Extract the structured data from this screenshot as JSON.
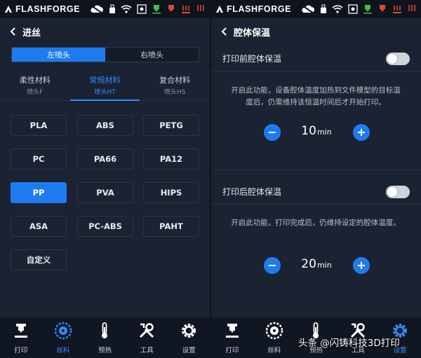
{
  "statusbar": {
    "logo": "FLASHFORGE"
  },
  "left": {
    "title": "进丝",
    "nozzles": [
      "左喷头",
      "右喷头"
    ],
    "categories": [
      {
        "name": "柔性材料",
        "sub": "喷头F"
      },
      {
        "name": "常规材料",
        "sub": "喷头HT"
      },
      {
        "name": "复合材料",
        "sub": "喷头HS"
      }
    ],
    "materials": [
      "PLA",
      "ABS",
      "PETG",
      "PC",
      "PA66",
      "PA12",
      "PP",
      "PVA",
      "HIPS",
      "ASA",
      "PC-ABS",
      "PAHT",
      "自定义"
    ],
    "selected_material": "PP"
  },
  "right": {
    "title": "腔体保温",
    "pre": {
      "label": "打印前腔体保温",
      "desc": "开启此功能，设备腔体温度加热到文件模型的目标温度后，仍需维持该恒温时间后才开始打印。",
      "value": "10",
      "unit": "min"
    },
    "post": {
      "label": "打印后腔体保温",
      "desc": "开启此功能，打印完成后，仍维持设定的腔体温度。",
      "value": "20",
      "unit": "min"
    }
  },
  "nav": [
    "打印",
    "丝料",
    "预热",
    "工具",
    "设置"
  ],
  "watermark": "头条 @闪铸科技3D打印",
  "colors": {
    "accent": "#1e7cf0",
    "background": "#1b2231",
    "statusbar": "#0e131c"
  }
}
